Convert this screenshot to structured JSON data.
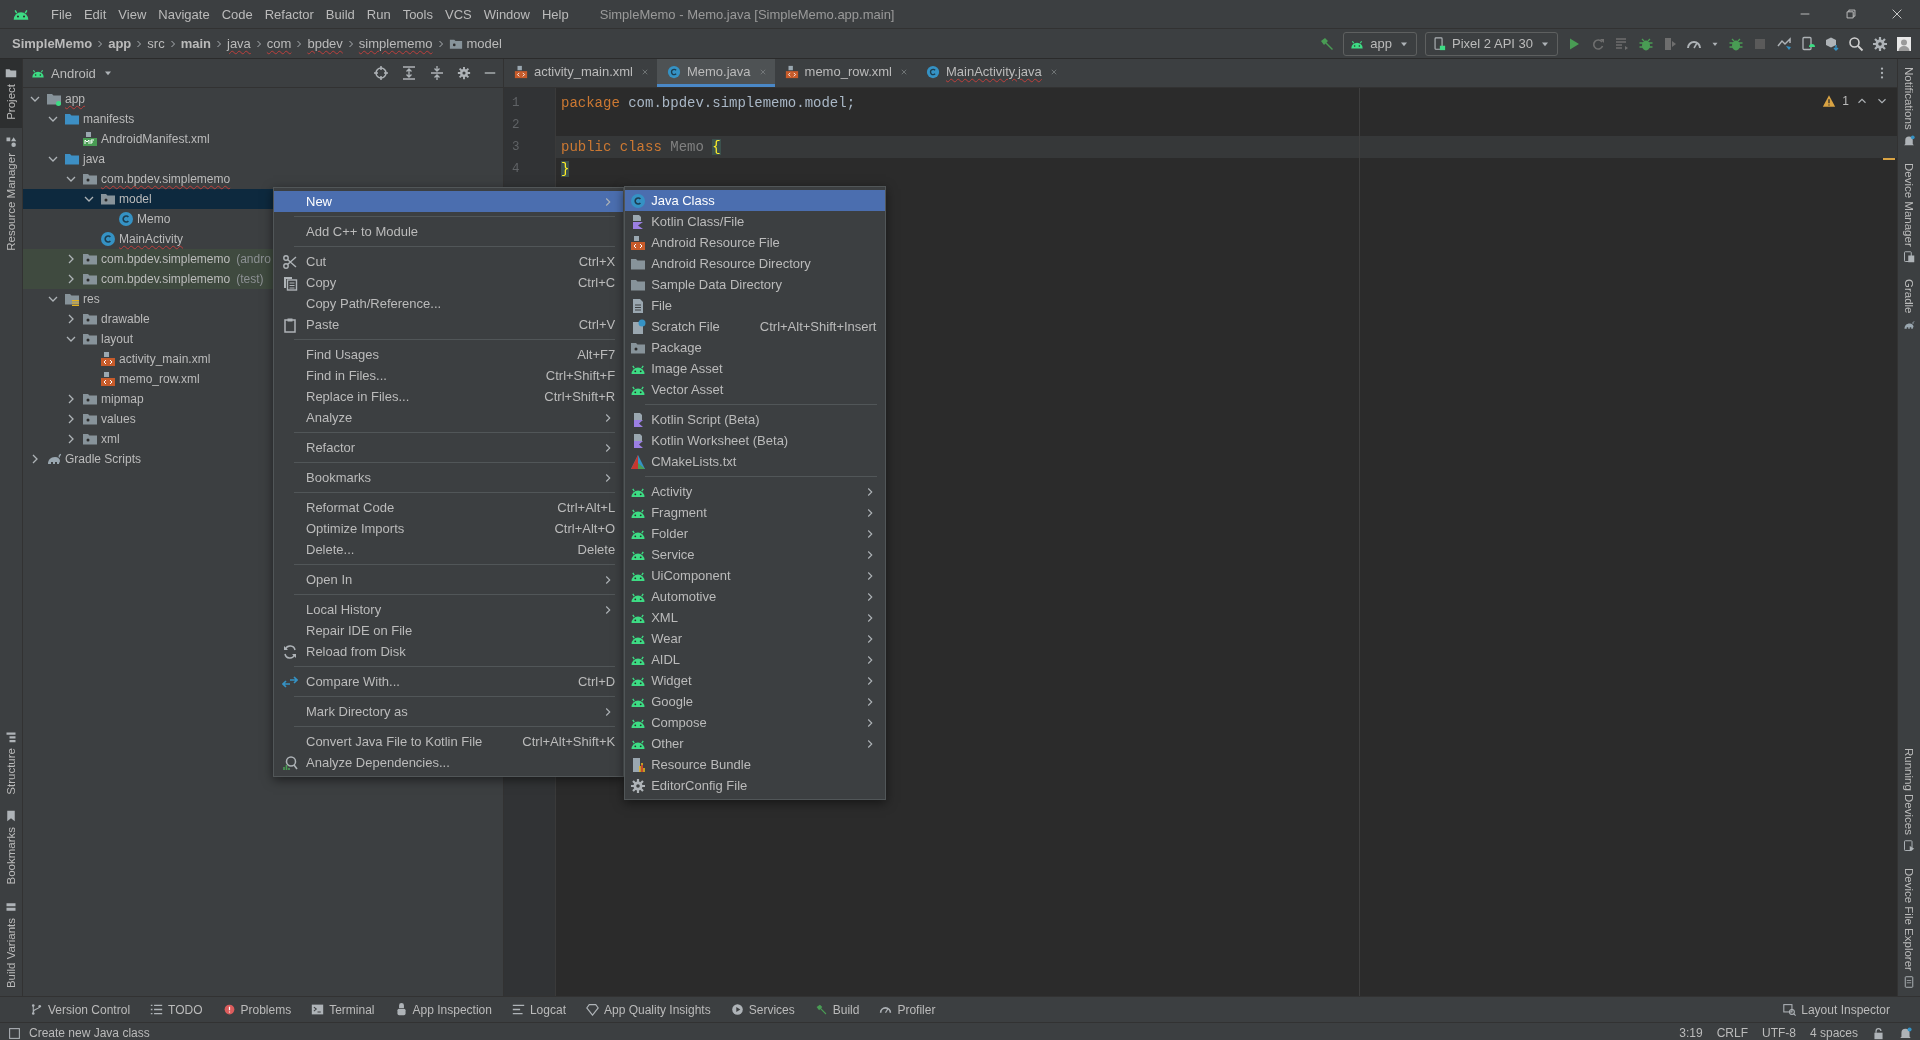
{
  "window": {
    "title": "SimpleMemo - Memo.java [SimpleMemo.app.main]"
  },
  "menu_bar": [
    "File",
    "Edit",
    "View",
    "Navigate",
    "Code",
    "Refactor",
    "Build",
    "Run",
    "Tools",
    "VCS",
    "Window",
    "Help"
  ],
  "breadcrumb": [
    {
      "label": "SimpleMemo",
      "bold": true,
      "underlined": false
    },
    {
      "label": "app",
      "bold": true,
      "underlined": false
    },
    {
      "label": "src",
      "bold": false,
      "underlined": false
    },
    {
      "label": "main",
      "bold": true,
      "underlined": false
    },
    {
      "label": "java",
      "bold": false,
      "underlined": true
    },
    {
      "label": "com",
      "bold": false,
      "underlined": true
    },
    {
      "label": "bpdev",
      "bold": false,
      "underlined": true
    },
    {
      "label": "simplememo",
      "bold": false,
      "underlined": true
    },
    {
      "label": "model",
      "bold": false,
      "underlined": false
    }
  ],
  "run_toolbar": {
    "configuration": "app",
    "device": "Pixel 2 API 30"
  },
  "left_tool_strip": {
    "top": [
      {
        "label": "Project",
        "selected": true
      },
      {
        "label": "Resource Manager",
        "selected": false
      }
    ],
    "bottom": [
      {
        "label": "Structure",
        "selected": false
      },
      {
        "label": "Bookmarks",
        "selected": false
      },
      {
        "label": "Build Variants",
        "selected": false
      }
    ]
  },
  "right_tool_strip": {
    "top": [
      "Notifications",
      "Device Manager",
      "Gradle"
    ],
    "bottom": [
      "Running Devices",
      "Device File Explorer"
    ]
  },
  "project_panel": {
    "view": "Android",
    "tree": [
      {
        "label": "app",
        "kind": "module",
        "expanded": true,
        "selected": false,
        "underlined": true,
        "children": [
          {
            "label": "manifests",
            "kind": "source-folder",
            "expanded": true,
            "selected": false,
            "underlined": false,
            "children": [
              {
                "label": "AndroidManifest.xml",
                "kind": "manifest",
                "selected": false,
                "underlined": false
              }
            ]
          },
          {
            "label": "java",
            "kind": "source-folder",
            "expanded": true,
            "selected": false,
            "underlined": false,
            "children": [
              {
                "label": "com.bpdev.simplememo",
                "kind": "package",
                "expanded": true,
                "selected": false,
                "underlined": true,
                "children": [
                  {
                    "label": "model",
                    "kind": "package",
                    "expanded": true,
                    "selected": true,
                    "underlined": false,
                    "children": [
                      {
                        "label": "Memo",
                        "kind": "class",
                        "selected": false,
                        "underlined": false
                      }
                    ]
                  },
                  {
                    "label": "MainActivity",
                    "kind": "class",
                    "selected": false,
                    "underlined": true
                  }
                ]
              },
              {
                "label": "com.bpdev.simplememo",
                "suffix": "(andro",
                "kind": "test-package",
                "expanded": false,
                "selected": false,
                "underlined": false
              },
              {
                "label": "com.bpdev.simplememo",
                "suffix": "(test)",
                "kind": "test-package",
                "expanded": false,
                "selected": false,
                "underlined": false
              }
            ]
          },
          {
            "label": "res",
            "kind": "res-folder",
            "expanded": true,
            "selected": false,
            "underlined": false,
            "children": [
              {
                "label": "drawable",
                "kind": "package",
                "expanded": false,
                "selected": false,
                "underlined": false
              },
              {
                "label": "layout",
                "kind": "package",
                "expanded": true,
                "selected": false,
                "underlined": false,
                "children": [
                  {
                    "label": "activity_main.xml",
                    "kind": "xml",
                    "selected": false,
                    "underlined": false
                  },
                  {
                    "label": "memo_row.xml",
                    "kind": "xml",
                    "selected": false,
                    "underlined": false
                  }
                ]
              },
              {
                "label": "mipmap",
                "kind": "package",
                "expanded": false,
                "selected": false,
                "underlined": false
              },
              {
                "label": "values",
                "kind": "package",
                "expanded": false,
                "selected": false,
                "underlined": false
              },
              {
                "label": "xml",
                "kind": "package",
                "expanded": false,
                "selected": false,
                "underlined": false
              }
            ]
          }
        ]
      },
      {
        "label": "Gradle Scripts",
        "kind": "gradle",
        "expanded": false,
        "selected": false,
        "underlined": false
      }
    ]
  },
  "editor": {
    "tabs": [
      {
        "label": "activity_main.xml",
        "kind": "xml",
        "selected": false,
        "underlined": false
      },
      {
        "label": "Memo.java",
        "kind": "class",
        "selected": true,
        "underlined": false
      },
      {
        "label": "memo_row.xml",
        "kind": "xml",
        "selected": false,
        "underlined": false
      },
      {
        "label": "MainActivity.java",
        "kind": "class",
        "selected": false,
        "underlined": true
      }
    ],
    "warnings": "1",
    "lines": [
      {
        "number": "1",
        "current": false,
        "tokens": [
          {
            "kind": "keyword",
            "text": "package "
          },
          {
            "kind": "plain",
            "text": "com.bpdev.simplememo.model;"
          }
        ]
      },
      {
        "number": "2",
        "current": false
      },
      {
        "number": "3",
        "current": true,
        "tokens": [
          {
            "kind": "keyword",
            "text": "public "
          },
          {
            "kind": "keyword",
            "text": "class "
          },
          {
            "kind": "unused",
            "text": "Memo "
          },
          {
            "kind": "brace-match",
            "text": "{"
          }
        ]
      },
      {
        "number": "4",
        "current": false,
        "tokens": [
          {
            "kind": "brace-match",
            "text": "}"
          }
        ]
      }
    ]
  },
  "context_menu": {
    "groups": [
      [
        {
          "label": "New",
          "submenu": true,
          "selected": true
        }
      ],
      [
        {
          "label": "Add C++ to Module",
          "submenu": false,
          "selected": false
        }
      ],
      [
        {
          "label": "Cut",
          "shortcut": "Ctrl+X",
          "submenu": false,
          "selected": false
        },
        {
          "label": "Copy",
          "shortcut": "Ctrl+C",
          "submenu": false,
          "selected": false
        },
        {
          "label": "Copy Path/Reference...",
          "submenu": false,
          "selected": false
        },
        {
          "label": "Paste",
          "shortcut": "Ctrl+V",
          "submenu": false,
          "selected": false
        }
      ],
      [
        {
          "label": "Find Usages",
          "shortcut": "Alt+F7",
          "submenu": false,
          "selected": false
        },
        {
          "label": "Find in Files...",
          "shortcut": "Ctrl+Shift+F",
          "submenu": false,
          "selected": false
        },
        {
          "label": "Replace in Files...",
          "shortcut": "Ctrl+Shift+R",
          "submenu": false,
          "selected": false
        },
        {
          "label": "Analyze",
          "submenu": true,
          "selected": false
        }
      ],
      [
        {
          "label": "Refactor",
          "submenu": true,
          "selected": false
        }
      ],
      [
        {
          "label": "Bookmarks",
          "submenu": true,
          "selected": false
        }
      ],
      [
        {
          "label": "Reformat Code",
          "shortcut": "Ctrl+Alt+L",
          "submenu": false,
          "selected": false
        },
        {
          "label": "Optimize Imports",
          "shortcut": "Ctrl+Alt+O",
          "submenu": false,
          "selected": false
        },
        {
          "label": "Delete...",
          "shortcut": "Delete",
          "submenu": false,
          "selected": false
        }
      ],
      [
        {
          "label": "Open In",
          "submenu": true,
          "selected": false
        }
      ],
      [
        {
          "label": "Local History",
          "submenu": true,
          "selected": false
        },
        {
          "label": "Repair IDE on File",
          "submenu": false,
          "selected": false
        },
        {
          "label": "Reload from Disk",
          "submenu": false,
          "selected": false
        }
      ],
      [
        {
          "label": "Compare With...",
          "shortcut": "Ctrl+D",
          "submenu": false,
          "selected": false
        }
      ],
      [
        {
          "label": "Mark Directory as",
          "submenu": true,
          "selected": false
        }
      ],
      [
        {
          "label": "Convert Java File to Kotlin File",
          "shortcut": "Ctrl+Alt+Shift+K",
          "submenu": false,
          "selected": false
        },
        {
          "label": "Analyze Dependencies...",
          "submenu": false,
          "selected": false
        }
      ]
    ]
  },
  "new_submenu": {
    "groups": [
      [
        {
          "label": "Java Class",
          "submenu": false,
          "selected": true
        },
        {
          "label": "Kotlin Class/File",
          "submenu": false,
          "selected": false
        },
        {
          "label": "Android Resource File",
          "submenu": false,
          "selected": false
        },
        {
          "label": "Android Resource Directory",
          "submenu": false,
          "selected": false
        },
        {
          "label": "Sample Data Directory",
          "submenu": false,
          "selected": false
        },
        {
          "label": "File",
          "submenu": false,
          "selected": false
        },
        {
          "label": "Scratch File",
          "shortcut": "Ctrl+Alt+Shift+Insert",
          "submenu": false,
          "selected": false
        },
        {
          "label": "Package",
          "submenu": false,
          "selected": false
        },
        {
          "label": "Image Asset",
          "submenu": false,
          "selected": false
        },
        {
          "label": "Vector Asset",
          "submenu": false,
          "selected": false
        }
      ],
      [
        {
          "label": "Kotlin Script (Beta)",
          "submenu": false,
          "selected": false
        },
        {
          "label": "Kotlin Worksheet (Beta)",
          "submenu": false,
          "selected": false
        },
        {
          "label": "CMakeLists.txt",
          "submenu": false,
          "selected": false
        }
      ],
      [
        {
          "label": "Activity",
          "submenu": true,
          "selected": false
        },
        {
          "label": "Fragment",
          "submenu": true,
          "selected": false
        },
        {
          "label": "Folder",
          "submenu": true,
          "selected": false
        },
        {
          "label": "Service",
          "submenu": true,
          "selected": false
        },
        {
          "label": "UiComponent",
          "submenu": true,
          "selected": false
        },
        {
          "label": "Automotive",
          "submenu": true,
          "selected": false
        },
        {
          "label": "XML",
          "submenu": true,
          "selected": false
        },
        {
          "label": "Wear",
          "submenu": true,
          "selected": false
        },
        {
          "label": "AIDL",
          "submenu": true,
          "selected": false
        },
        {
          "label": "Widget",
          "submenu": true,
          "selected": false
        },
        {
          "label": "Google",
          "submenu": true,
          "selected": false
        },
        {
          "label": "Compose",
          "submenu": true,
          "selected": false
        },
        {
          "label": "Other",
          "submenu": true,
          "selected": false
        },
        {
          "label": "Resource Bundle",
          "submenu": false,
          "selected": false
        },
        {
          "label": "EditorConfig File",
          "submenu": false,
          "selected": false
        }
      ]
    ]
  },
  "tool_windows_bar": {
    "left": [
      "Version Control",
      "TODO",
      "Problems",
      "Terminal",
      "App Inspection",
      "Logcat",
      "App Quality Insights",
      "Services",
      "Build",
      "Profiler"
    ],
    "right": [
      "Layout Inspector"
    ]
  },
  "status_bar": {
    "message": "Create new Java class",
    "caret": "3:19",
    "line_separator": "CRLF",
    "encoding": "UTF-8",
    "indent": "4 spaces"
  }
}
